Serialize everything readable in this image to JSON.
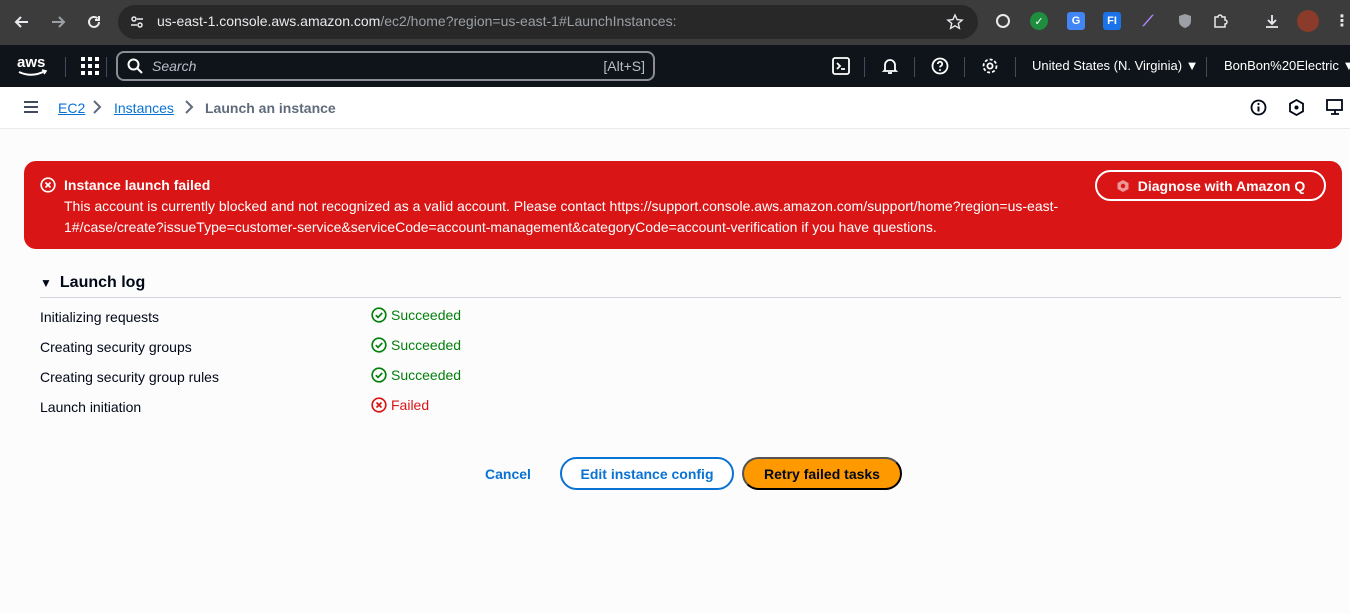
{
  "browser": {
    "url_host": "us-east-1.console.aws.amazon.com",
    "url_path": "/ec2/home?region=us-east-1#LaunchInstances:"
  },
  "awsnav": {
    "search_placeholder": "Search",
    "search_shortcut": "[Alt+S]",
    "region": "United States (N. Virginia)",
    "account": "BonBon%20Electric"
  },
  "breadcrumb": {
    "items": [
      "EC2",
      "Instances"
    ],
    "current": "Launch an instance"
  },
  "alert": {
    "title": "Instance launch failed",
    "message": "This account is currently blocked and not recognized as a valid account. Please contact https://support.console.aws.amazon.com/support/home?region=us-east-1#/case/create?issueType=customer-service&serviceCode=account-management&categoryCode=account-verification if you have questions.",
    "action_label": "Diagnose with Amazon Q",
    "color": "#d91515"
  },
  "launch_log": {
    "title": "Launch log",
    "rows": [
      {
        "label": "Initializing requests",
        "status": "Succeeded",
        "state": "success"
      },
      {
        "label": "Creating security groups",
        "status": "Succeeded",
        "state": "success"
      },
      {
        "label": "Creating security group rules",
        "status": "Succeeded",
        "state": "success"
      },
      {
        "label": "Launch initiation",
        "status": "Failed",
        "state": "error"
      }
    ]
  },
  "actions": {
    "cancel": "Cancel",
    "edit": "Edit instance config",
    "retry": "Retry failed tasks"
  },
  "colors": {
    "primary": "#0972d3",
    "success": "#037f0c",
    "error": "#d91515",
    "accent": "#ff9900"
  }
}
